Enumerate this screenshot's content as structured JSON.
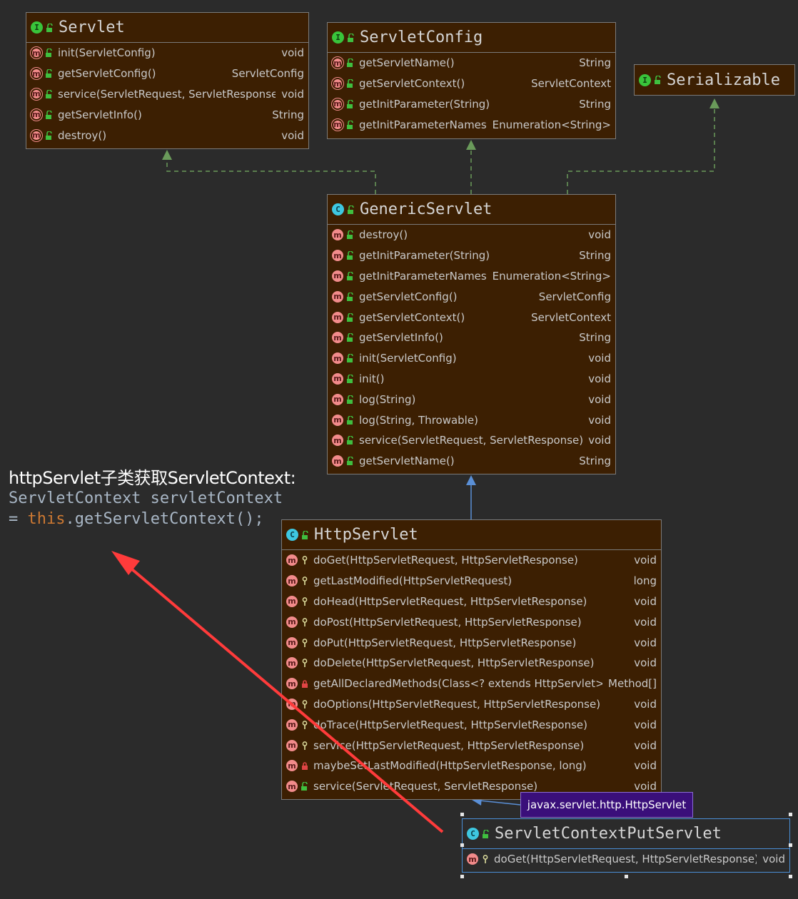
{
  "boxes": {
    "servlet": {
      "name": "Servlet",
      "kind": "I",
      "methods": [
        {
          "name": "init(ServletConfig)",
          "ret": "void"
        },
        {
          "name": "getServletConfig()",
          "ret": "ServletConfig"
        },
        {
          "name": "service(ServletRequest, ServletResponse)",
          "ret": "void"
        },
        {
          "name": "getServletInfo()",
          "ret": "String"
        },
        {
          "name": "destroy()",
          "ret": "void"
        }
      ]
    },
    "servletconfig": {
      "name": "ServletConfig",
      "kind": "I",
      "methods": [
        {
          "name": "getServletName()",
          "ret": "String"
        },
        {
          "name": "getServletContext()",
          "ret": "ServletContext"
        },
        {
          "name": "getInitParameter(String)",
          "ret": "String"
        },
        {
          "name": "getInitParameterNames()",
          "ret": "Enumeration<String>"
        }
      ]
    },
    "serializable": {
      "name": "Serializable",
      "kind": "I",
      "methods": []
    },
    "genericservlet": {
      "name": "GenericServlet",
      "kind": "C",
      "methods": [
        {
          "name": "destroy()",
          "ret": "void"
        },
        {
          "name": "getInitParameter(String)",
          "ret": "String"
        },
        {
          "name": "getInitParameterNames()",
          "ret": "Enumeration<String>"
        },
        {
          "name": "getServletConfig()",
          "ret": "ServletConfig"
        },
        {
          "name": "getServletContext()",
          "ret": "ServletContext"
        },
        {
          "name": "getServletInfo()",
          "ret": "String"
        },
        {
          "name": "init(ServletConfig)",
          "ret": "void"
        },
        {
          "name": "init()",
          "ret": "void"
        },
        {
          "name": "log(String)",
          "ret": "void"
        },
        {
          "name": "log(String, Throwable)",
          "ret": "void"
        },
        {
          "name": "service(ServletRequest, ServletResponse)",
          "ret": "void"
        },
        {
          "name": "getServletName()",
          "ret": "String"
        }
      ]
    },
    "httpservlet": {
      "name": "HttpServlet",
      "kind": "C",
      "methods": [
        {
          "name": "doGet(HttpServletRequest, HttpServletResponse)",
          "ret": "void"
        },
        {
          "name": "getLastModified(HttpServletRequest)",
          "ret": "long"
        },
        {
          "name": "doHead(HttpServletRequest, HttpServletResponse)",
          "ret": "void"
        },
        {
          "name": "doPost(HttpServletRequest, HttpServletResponse)",
          "ret": "void"
        },
        {
          "name": "doPut(HttpServletRequest, HttpServletResponse)",
          "ret": "void"
        },
        {
          "name": "doDelete(HttpServletRequest, HttpServletResponse)",
          "ret": "void"
        },
        {
          "name": "getAllDeclaredMethods(Class<? extends HttpServlet>)",
          "ret": "Method[]"
        },
        {
          "name": "doOptions(HttpServletRequest, HttpServletResponse)",
          "ret": "void"
        },
        {
          "name": "doTrace(HttpServletRequest, HttpServletResponse)",
          "ret": "void"
        },
        {
          "name": "service(HttpServletRequest, HttpServletResponse)",
          "ret": "void"
        },
        {
          "name": "maybeSetLastModified(HttpServletResponse, long)",
          "ret": "void"
        },
        {
          "name": "service(ServletRequest, ServletResponse)",
          "ret": "void"
        }
      ]
    },
    "contextput": {
      "name": "ServletContextPutServlet",
      "kind": "C",
      "methods": [
        {
          "name": "doGet(HttpServletRequest, HttpServletResponse)",
          "ret": "void"
        }
      ]
    }
  },
  "caption": {
    "line1": "httpServlet子类获取ServletContext:",
    "line2": "ServletContext servletContext",
    "line3_prefix": "= ",
    "line3_kw": "this",
    "line3_rest": ".getServletContext();"
  },
  "tooltip": "javax.servlet.http.HttpServlet",
  "colors": {
    "box_bg": "#3c1f02",
    "arrow_red": "#ff3b3b",
    "dashed_green": "#6a9a5a",
    "solid_blue": "#5a8fd6"
  }
}
